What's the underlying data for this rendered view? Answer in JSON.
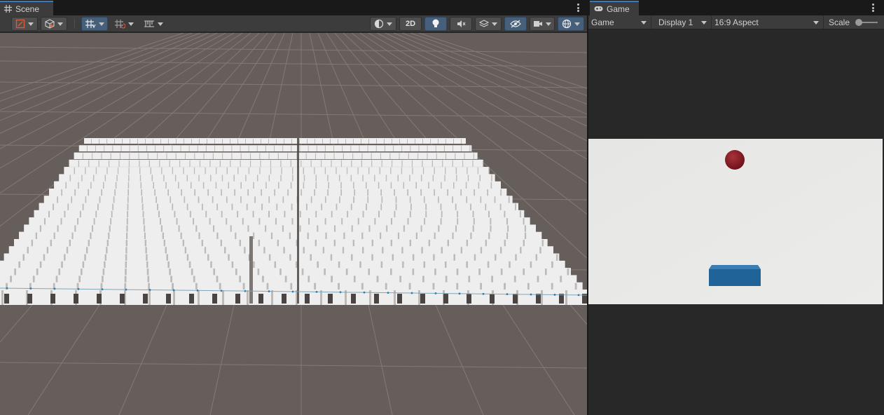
{
  "scene_panel": {
    "tab_label": "Scene",
    "tab_icon": "grid-hash-icon",
    "toolbar": {
      "gizmo_tools": [
        "draw-mode-icon",
        "shading-cube-icon"
      ],
      "snap_tools": [
        "grid-snap-icon",
        "increment-snap-icon",
        "ruler-icon"
      ],
      "shading_mode_icon": "sphere-shading-icon",
      "two_d_label": "2D",
      "lighting_icon": "light-bulb-icon",
      "audio_icon": "mute-audio-icon",
      "effects_icon": "effects-layers-icon",
      "visibility_icon": "hidden-eye-icon",
      "camera_icon": "camera-icon",
      "gizmos_icon": "gizmos-globe-icon"
    },
    "colors": {
      "ground": "#665e5a",
      "grid_line": "#8a827c",
      "block_face": "#eeeeee",
      "block_shadow": "#4a4542",
      "accent": "#3a79bb"
    }
  },
  "game_panel": {
    "tab_label": "Game",
    "tab_icon": "gamepad-icon",
    "toolbar": {
      "mode_value": "Game",
      "display_value": "Display 1",
      "aspect_value": "16:9 Aspect",
      "scale_label": "Scale"
    },
    "colors": {
      "background": "#e8e8e6",
      "ball": "#8b1d26",
      "paddle": "#1f6399"
    }
  }
}
